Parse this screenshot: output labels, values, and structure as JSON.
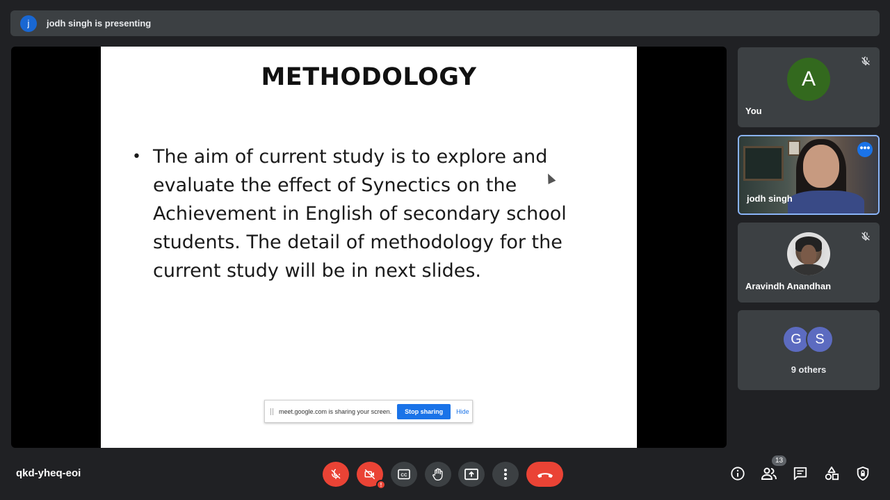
{
  "presenting_banner": {
    "avatar_letter": "j",
    "text": "jodh singh is presenting"
  },
  "slide": {
    "title": "METHODOLOGY",
    "bullet": "•",
    "body": "The aim of current study is to explore and evaluate the effect of Synectics on the Achievement in English of secondary school students. The detail of methodology for the current study will be in next slides."
  },
  "share_bar": {
    "text": "meet.google.com is sharing your screen.",
    "stop_label": "Stop sharing",
    "hide_label": "Hide"
  },
  "participants": [
    {
      "name": "You",
      "avatar_letter": "A",
      "avatar_color": "#33691e",
      "muted": true
    },
    {
      "name": "jodh singh",
      "video": true
    },
    {
      "name": "Aravindh Anandhan",
      "muted": true
    },
    {
      "name": "9 others",
      "avatar_letters": [
        "G",
        "S"
      ]
    }
  ],
  "meeting_code": "qkd-yheq-eoi",
  "people_count": "13",
  "colors": {
    "end_call": "#ea4335",
    "accent": "#1a73e8",
    "tile_bg": "#3c4043"
  }
}
